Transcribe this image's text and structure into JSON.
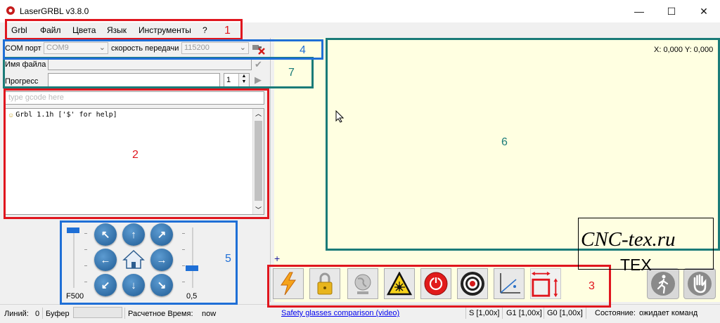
{
  "window": {
    "title": "LaserGRBL v3.8.0",
    "minimize": "—",
    "maximize": "☐",
    "close": "✕"
  },
  "menu": [
    "Grbl",
    "Файл",
    "Цвета",
    "Язык",
    "Инструменты",
    "?"
  ],
  "connection": {
    "port_label": "COM порт",
    "port_value": "COM9",
    "baud_label": "скорость передачи",
    "baud_value": "115200"
  },
  "file": {
    "label": "Имя файла",
    "value": ""
  },
  "progress": {
    "label": "Прогресс",
    "passes": "1",
    "fraction": 0
  },
  "console": {
    "input_placeholder": "type gcode here",
    "lines": [
      "Grbl 1.1h ['$' for help]"
    ]
  },
  "jog": {
    "speed_label": "F500",
    "step_label": "0,5"
  },
  "canvas": {
    "coords": "X: 0,000 Y: 0,000"
  },
  "toolbar_icons": [
    "lightning-icon",
    "padlock-icon",
    "globe-icon",
    "laser-warning-icon",
    "power-icon",
    "target-icon",
    "axes-icon",
    "frame-icon",
    "walk-icon",
    "hand-stop-icon"
  ],
  "status": {
    "lines_label": "Линий:",
    "lines_value": "0",
    "buffer_label": "Буфер",
    "time_label": "Расчетное Время:",
    "time_value": "now",
    "link": "Safety glasses comparison (video)",
    "s_override": "S [1,00x]",
    "g1_override": "G1 [1,00x]",
    "g0_override": "G0 [1,00x]",
    "state_label": "Состояние:",
    "state_value": "ожидает команд"
  },
  "annotations": [
    "1",
    "2",
    "3",
    "4",
    "5",
    "6",
    "7"
  ],
  "watermark": {
    "line1": "CNC-tex.ru",
    "line2": "TEX"
  },
  "colors": {
    "annotation_red": "#e0161e",
    "annotation_blue": "#1f6fd6",
    "annotation_teal": "#1a7b78",
    "canvas_bg": "#ffffe1",
    "link": "#0000ee"
  }
}
